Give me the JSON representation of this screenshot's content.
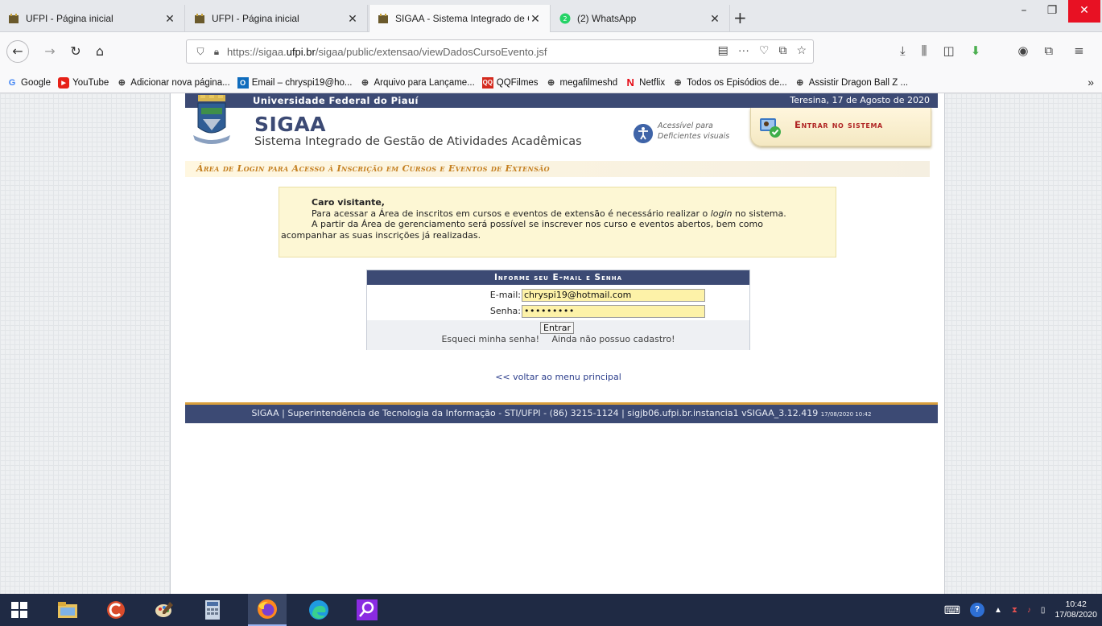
{
  "browser": {
    "tabs": [
      {
        "label": "UFPI - Página inicial",
        "active": false
      },
      {
        "label": "UFPI - Página inicial",
        "active": false
      },
      {
        "label": "SIGAA - Sistema Integrado de G",
        "active": true
      },
      {
        "label": "(2) WhatsApp",
        "active": false
      }
    ],
    "new_tab": "+",
    "url_prefix": "https://sigaa.",
    "url_domain": "ufpi.br",
    "url_path": "/sigaa/public/extensao/viewDadosCursoEvento.jsf",
    "bookmarks": [
      {
        "label": "Google",
        "icon": "google-icon"
      },
      {
        "label": "YouTube",
        "icon": "youtube-icon"
      },
      {
        "label": "Adicionar nova página...",
        "icon": "globe-icon"
      },
      {
        "label": "Email – chryspi19@ho...",
        "icon": "outlook-icon"
      },
      {
        "label": "Arquivo para Lançame...",
        "icon": "globe-icon"
      },
      {
        "label": "QQFilmes",
        "icon": "qqfilmes-icon"
      },
      {
        "label": "megafilmeshd",
        "icon": "globe-icon"
      },
      {
        "label": "Netflix",
        "icon": "netflix-icon"
      },
      {
        "label": "Todos os Episódios de...",
        "icon": "globe-icon"
      },
      {
        "label": "Assistir Dragon Ball Z ...",
        "icon": "globe-icon"
      }
    ],
    "bookmarks_overflow": "»"
  },
  "header": {
    "institution": "Universidade Federal do Piauí",
    "date": "Teresina, 17 de Agosto de 2020",
    "system_name": "SIGAA",
    "system_subtitle": "Sistema Integrado de Gestão de Atividades Acadêmicas",
    "accessibility_line1": "Acessível para",
    "accessibility_line2": "Deficientes visuais",
    "enter_system": "Entrar no sistema"
  },
  "area_title": "Área de Login para Acesso à Inscrição em Cursos e Eventos de Extensão",
  "notice": {
    "greeting": "Caro visitante,",
    "line1_before": "Para acessar a Área de inscritos em cursos e eventos de extensão é necessário realizar o ",
    "line1_italic": "login",
    "line1_after": " no sistema.",
    "line2": "A partir da Área de gerenciamento será possível se inscrever nos curso e eventos abertos, bem como",
    "line3": "acompanhar as suas inscrições já realizadas."
  },
  "login": {
    "heading": "Informe seu E-mail e Senha",
    "email_label": "E-mail:",
    "email_value": "chryspi19@hotmail.com",
    "password_label": "Senha:",
    "password_value": "•••••••••",
    "submit": "Entrar",
    "forgot": "Esqueci minha senha!",
    "no_account": "Ainda não possuo cadastro!"
  },
  "back_link": "<< voltar ao menu principal",
  "footer": {
    "text": "SIGAA | Superintendência de Tecnologia da Informação - STI/UFPI - (86) 3215-1124 | sigjb06.ufpi.br.instancia1 vSIGAA_3.12.419",
    "timestamp": "17/08/2020 10:42"
  },
  "taskbar": {
    "time": "10:42",
    "date": "17/08/2020"
  },
  "colors": {
    "sigaa_blue": "#3c4a74",
    "notice_bg": "#fdf7d4",
    "accent_orange": "#c47f1f",
    "enter_red": "#b02525"
  }
}
